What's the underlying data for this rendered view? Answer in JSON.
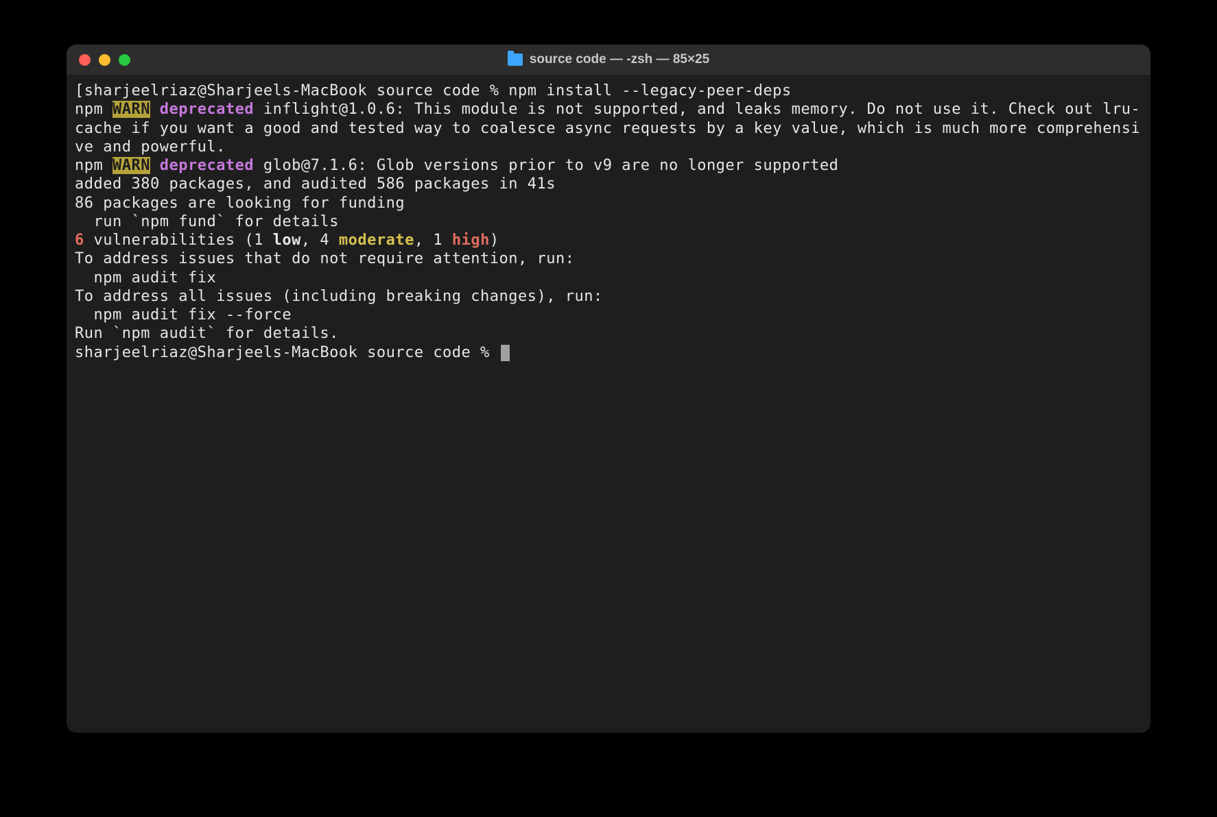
{
  "window": {
    "title": "source code — -zsh — 85×25"
  },
  "colors": {
    "warn_bg": "#b5a33a",
    "deprecated": "#c678dd",
    "red": "#e06c5c",
    "moderate": "#d7c150",
    "high": "#e06c5c",
    "text": "#e6e6e6",
    "bg": "#1e1e1e"
  },
  "terminal": {
    "prompt1_prefix": "[",
    "prompt1": "sharjeelriaz@Sharjeels-MacBook source code % ",
    "command": "npm install --legacy-peer-deps",
    "npm_label": "npm ",
    "warn_label": "WARN",
    "deprecated_label": " deprecated",
    "warn1_msg": " inflight@1.0.6: This module is not supported, and leaks memory. Do not use it. Check out lru-cache if you want a good and tested way to coalesce async requests by a key value, which is much more comprehensive and powerful.",
    "warn2_msg": " glob@7.1.6: Glob versions prior to v9 are no longer supported",
    "blank": "",
    "added_line": "added 380 packages, and audited 586 packages in 41s",
    "funding_line1": "86 packages are looking for funding",
    "funding_line2": "  run `npm fund` for details",
    "vuln_count": "6",
    "vuln_text1": " vulnerabilities (1 ",
    "vuln_low": "low",
    "vuln_text2": ", 4 ",
    "vuln_moderate": "moderate",
    "vuln_text3": ", 1 ",
    "vuln_high": "high",
    "vuln_text4": ")",
    "address1_line1": "To address issues that do not require attention, run:",
    "address1_line2": "  npm audit fix",
    "address2_line1": "To address all issues (including breaking changes), run:",
    "address2_line2": "  npm audit fix --force",
    "run_audit": "Run `npm audit` for details.",
    "prompt2": "sharjeelriaz@Sharjeels-MacBook source code % "
  }
}
